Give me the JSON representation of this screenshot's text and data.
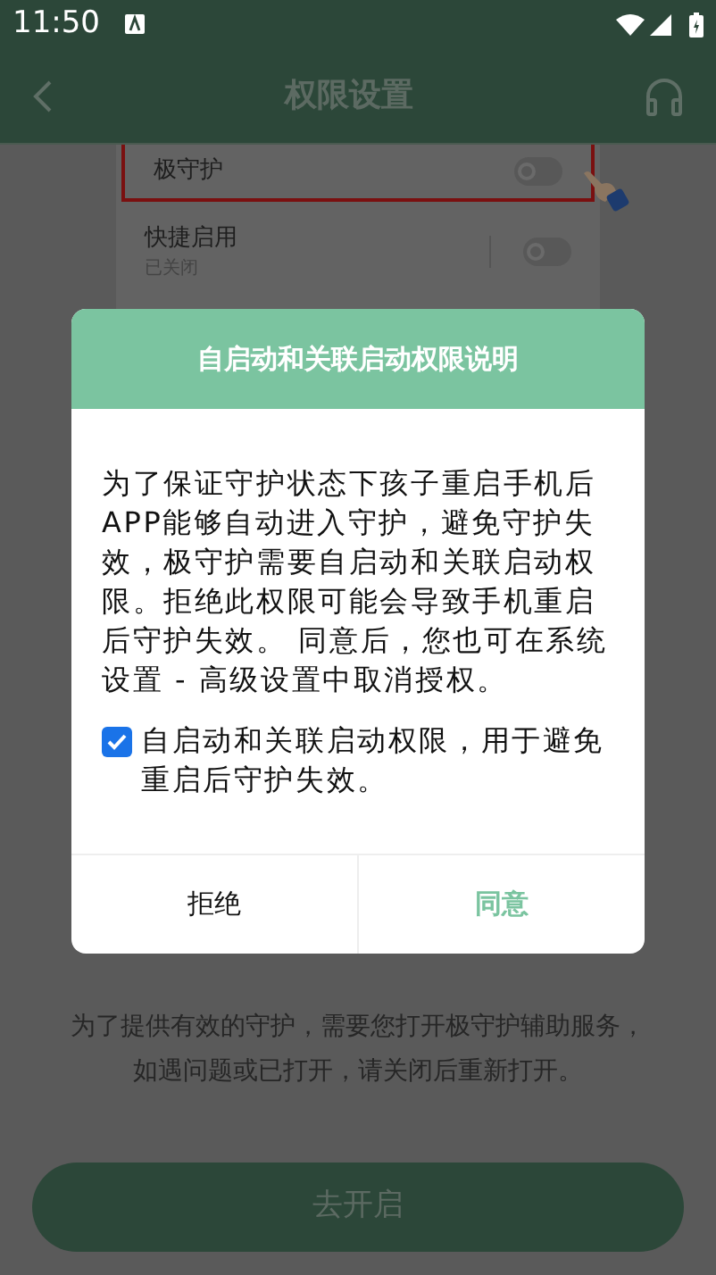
{
  "status_bar": {
    "time": "11:50"
  },
  "header": {
    "title": "权限设置"
  },
  "card": {
    "rows": [
      {
        "label": "极守护",
        "sublabel": null,
        "on": false,
        "highlighted": true
      },
      {
        "label": "快捷启用",
        "sublabel": "已关闭",
        "on": false,
        "highlighted": false
      }
    ]
  },
  "description": "为了提供有效的守护，需要您打开极守护辅助服务，如遇问题或已打开，请关闭后重新打开。",
  "primary_button": "去开启",
  "dialog": {
    "title": "自启动和关联启动权限说明",
    "body": "为了保证守护状态下孩子重启手机后APP能够自动进入守护，避免守护失效，极守护需要自启动和关联启动权限。拒绝此权限可能会导致手机重启后守护失效。 同意后，您也可在系统设置 - 高级设置中取消授权。",
    "consent": {
      "label": "自启动和关联启动权限，用于避免重启后守护失效。",
      "checked": true
    },
    "buttons": [
      {
        "label": "拒绝",
        "kind": "secondary"
      },
      {
        "label": "同意",
        "kind": "primary"
      }
    ]
  }
}
